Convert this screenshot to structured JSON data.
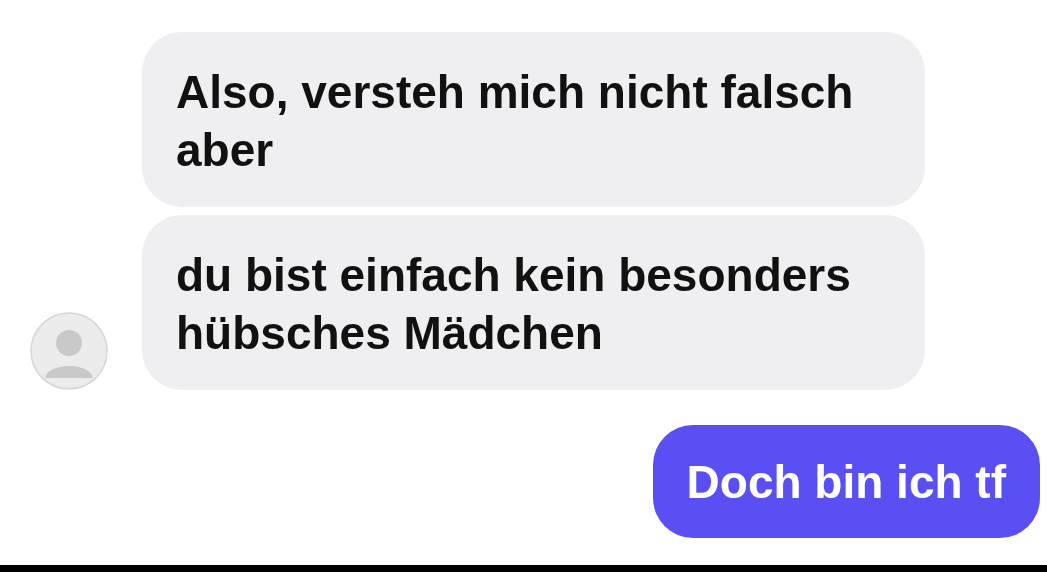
{
  "messages": [
    {
      "kind": "received",
      "text": "Also, versteh mich nicht falsch aber",
      "show_avatar": false
    },
    {
      "kind": "received",
      "text": "du bist einfach kein besonders hübsches Mädchen",
      "show_avatar": true
    },
    {
      "kind": "sent",
      "text": "Doch bin ich tf",
      "show_avatar": false
    }
  ]
}
